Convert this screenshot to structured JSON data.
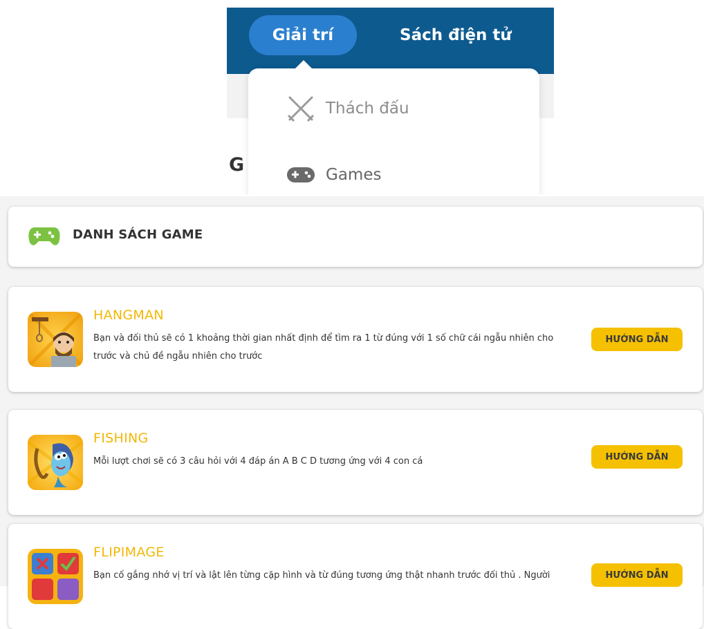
{
  "nav": {
    "active_tab": "Giải trí",
    "tab_ebooks": "Sách điện tử",
    "partial_heading_letter": "G",
    "dropdown": [
      {
        "label": "Thách đấu",
        "icon": "swords-icon"
      },
      {
        "label": "Games",
        "icon": "gamepad-icon"
      }
    ]
  },
  "list": {
    "header_icon": "gamepad-icon",
    "title": "DANH SÁCH GAME",
    "guide_label": "HƯỚNG DẪN",
    "games": [
      {
        "name": "HANGMAN",
        "desc": "Bạn và đối thủ sẽ có 1 khoảng thời gian nhất định để tìm ra 1 từ đúng với 1 số chữ cái ngẫu nhiên cho trước và chủ đề ngẫu nhiên cho trước",
        "thumb_icon": "hangman-thumbnail"
      },
      {
        "name": "FISHING",
        "desc": "Mỗi lượt chơi sẽ có 3 câu hỏi với 4 đáp án A B C D tương ứng với 4 con cá",
        "thumb_icon": "fishing-thumbnail"
      },
      {
        "name": "FLIPIMAGE",
        "desc": "Bạn cố gắng nhớ vị trí và lật lên từng cặp hình và từ đúng tương ứng thật nhanh trước đối thủ . Người",
        "thumb_icon": "flipimage-thumbnail"
      }
    ]
  },
  "colors": {
    "nav_bar": "#0d5a8f",
    "nav_active": "#2b7fcf",
    "accent_yellow": "#f5c000",
    "game_title": "#f2b705",
    "gamepad_green": "#7cc242"
  }
}
